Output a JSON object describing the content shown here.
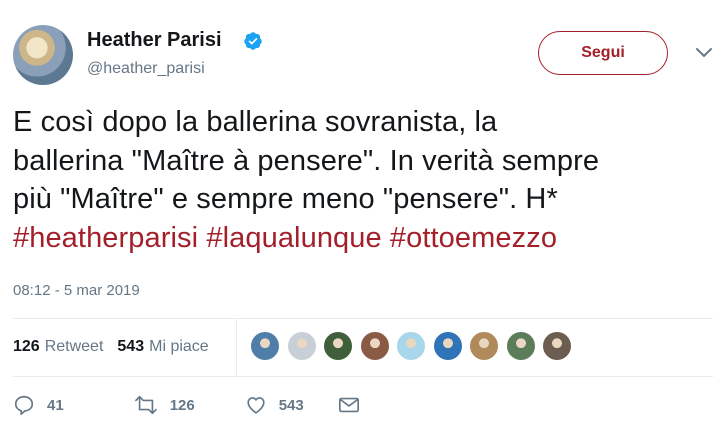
{
  "author": {
    "name": "Heather Parisi",
    "handle": "@heather_parisi",
    "verified": true
  },
  "follow_button": {
    "label": "Segui"
  },
  "tweet": {
    "lines": [
      "E così dopo la ballerina sovranista, la",
      "ballerina \"Maître à pensere\". In verità sempre",
      "più \"Maître\" e sempre meno \"pensere\". H*"
    ],
    "hashtags": [
      "#heatherparisi",
      "#laqualunque",
      "#ottoemezzo"
    ],
    "timestamp": "08:12 - 5 mar 2019"
  },
  "stats": {
    "retweets_count": "126",
    "retweets_label": "Retweet",
    "likes_count": "543",
    "likes_label": "Mi piace"
  },
  "likers": [
    {
      "name": "liker-1",
      "color": "#4f7ea8"
    },
    {
      "name": "liker-2",
      "color": "#c8cfd6"
    },
    {
      "name": "liker-3",
      "color": "#3f5f3b"
    },
    {
      "name": "liker-4",
      "color": "#8a5a44"
    },
    {
      "name": "liker-5",
      "color": "#a8d6ea"
    },
    {
      "name": "liker-6",
      "color": "#2f73b8"
    },
    {
      "name": "liker-7",
      "color": "#b08a5a"
    },
    {
      "name": "liker-8",
      "color": "#5b7d5a"
    },
    {
      "name": "liker-9",
      "color": "#6b5d50"
    }
  ],
  "actions": {
    "reply_count": "41",
    "retweet_count": "126",
    "like_count": "543"
  },
  "colors": {
    "accent": "#a3202b",
    "muted": "#657786",
    "verified": "#1da1f2"
  }
}
